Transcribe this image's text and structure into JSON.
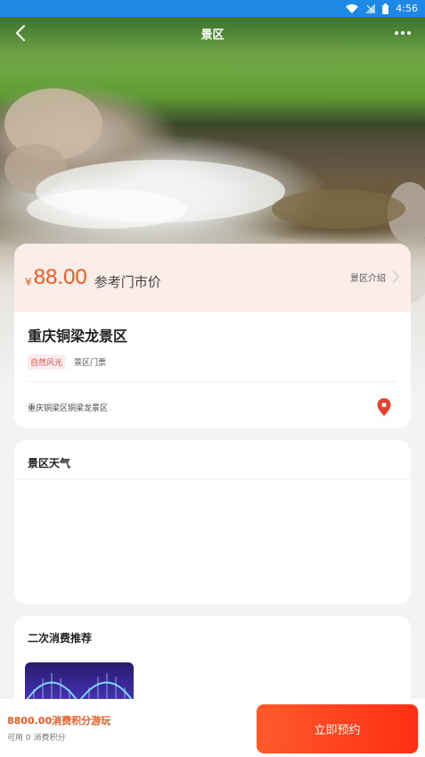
{
  "status_bar": {
    "time": "4:56"
  },
  "nav": {
    "title": "景区"
  },
  "ticket": {
    "currency_symbol": "¥",
    "price": "88.00",
    "price_label": "参考门市价",
    "intro_link": "景区介绍"
  },
  "spot": {
    "name": "重庆铜梁龙景区",
    "tags": [
      "自然风光",
      "景区门票"
    ],
    "address": "重庆铜梁区铜梁龙景区"
  },
  "weather": {
    "title": "景区天气"
  },
  "recommend": {
    "title": "二次消费推荐"
  },
  "bottom": {
    "points_offer": "8800.00消费积分游玩",
    "points_available": "可用 0 消费积分",
    "book_button": "立即预约"
  },
  "colors": {
    "status_bar": "#1e88e5",
    "accent": "#f05a1e",
    "price_band": "#fbeee9",
    "button_gradient_start": "#ff5a2b",
    "button_gradient_end": "#ff2e14",
    "location_pin": "#e8412c"
  },
  "icons": {
    "status": [
      "wifi-icon",
      "signal-icon",
      "battery-icon"
    ],
    "nav": [
      "back-arrow-icon",
      "more-icon"
    ],
    "card": [
      "chevron-right-icon",
      "location-pin-icon"
    ]
  }
}
